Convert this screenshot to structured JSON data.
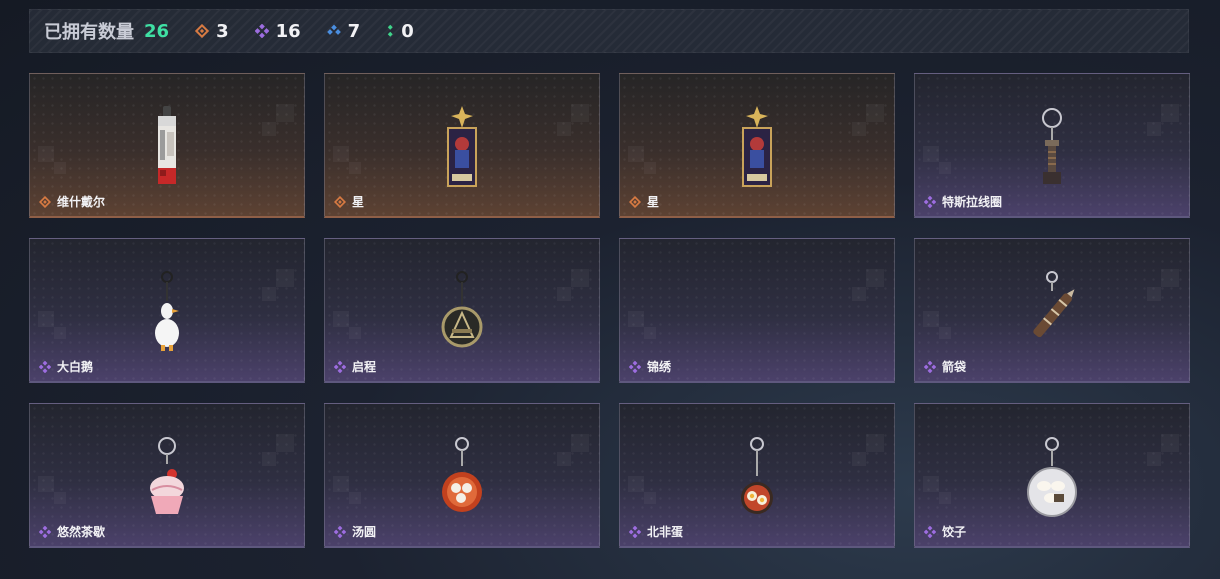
{
  "stats": {
    "title": "已拥有数量",
    "total": "26",
    "rarities": [
      {
        "name": "orange",
        "icon": "orange-diamond-icon",
        "color": "#d77a42",
        "count": "3"
      },
      {
        "name": "purple",
        "icon": "purple-cluster-icon",
        "color": "#9d6de0",
        "count": "16"
      },
      {
        "name": "blue",
        "icon": "blue-cluster-icon",
        "color": "#4a8ee0",
        "count": "7"
      },
      {
        "name": "green",
        "icon": "green-dots-icon",
        "color": "#3fd48a",
        "count": "0"
      }
    ]
  },
  "items": [
    {
      "name": "维什戴尔",
      "rarity": "orange",
      "art": "red-phone-strap-icon"
    },
    {
      "name": "星",
      "rarity": "orange",
      "art": "star-tarot-card-icon"
    },
    {
      "name": "星",
      "rarity": "orange",
      "art": "star-tarot-card-icon"
    },
    {
      "name": "特斯拉线圈",
      "rarity": "purple",
      "art": "tesla-coil-keychain-icon"
    },
    {
      "name": "大白鹅",
      "rarity": "purple",
      "art": "white-goose-keychain-icon"
    },
    {
      "name": "启程",
      "rarity": "purple",
      "art": "medallion-keychain-icon"
    },
    {
      "name": "锦绣",
      "rarity": "purple",
      "art": ""
    },
    {
      "name": "箭袋",
      "rarity": "purple",
      "art": "quiver-keychain-icon"
    },
    {
      "name": "悠然茶歇",
      "rarity": "purple",
      "art": "cupcake-keychain-icon"
    },
    {
      "name": "汤圆",
      "rarity": "purple",
      "art": "tangyuan-bowl-keychain-icon"
    },
    {
      "name": "北非蛋",
      "rarity": "purple",
      "art": "shakshuka-pan-keychain-icon"
    },
    {
      "name": "饺子",
      "rarity": "purple",
      "art": "dumpling-plate-keychain-icon"
    }
  ]
}
